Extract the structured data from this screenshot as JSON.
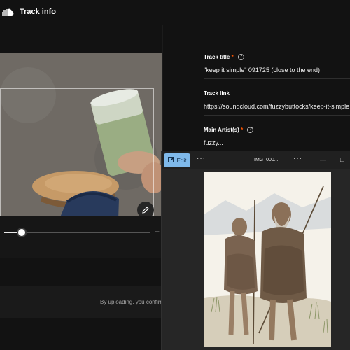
{
  "app": {
    "title": "Track info",
    "logo_icon": "soundcloud-logo-icon"
  },
  "editor": {
    "zoom_level": 0.12,
    "zoom_plus_label": "+",
    "disclaimer": "By uploading, you confirm"
  },
  "track_info": {
    "title_label": "Track title",
    "title_value": "\"keep it simple\" 091725 (close to the end)",
    "link_label": "Track link",
    "link_value": "https://soundcloud.com/fuzzybuttocks/keep-it-simple",
    "artist_label": "Main Artist(s)",
    "artist_value": "fuzzy...",
    "required_marker": "*",
    "help_glyph": "?"
  },
  "viewer": {
    "edit_label": "Edit",
    "filename": "IMG_000...",
    "more_glyph": "···",
    "minimize_glyph": "—",
    "maximize_glyph": "□"
  },
  "colors": {
    "accent": "#ff5500",
    "edit_button": "#7fb9ea"
  }
}
